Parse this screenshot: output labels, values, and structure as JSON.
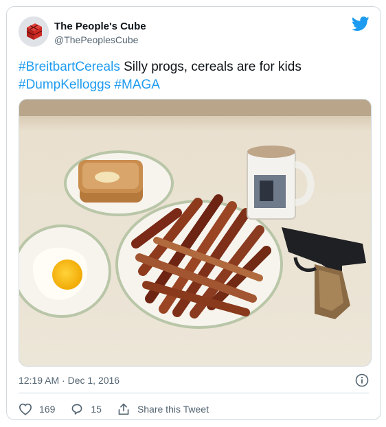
{
  "user": {
    "display_name": "The People's Cube",
    "handle": "@ThePeoplesCube"
  },
  "tweet": {
    "hashtag_1": "#BreitbartCereals",
    "text_1": " Silly progs, cereals are for kids",
    "hashtag_2": "#DumpKelloggs",
    "hashtag_3": "#MAGA"
  },
  "timestamp": "12:19 AM · Dec 1, 2016",
  "actions": {
    "like_count": "169",
    "reply_count": "15",
    "share_label": "Share this Tweet"
  },
  "colors": {
    "accent": "#1d9bf0",
    "muted": "#536471",
    "border": "#cfd9de"
  },
  "icons": [
    "twitter-bird-icon",
    "info-icon",
    "heart-icon",
    "reply-icon",
    "share-icon"
  ]
}
